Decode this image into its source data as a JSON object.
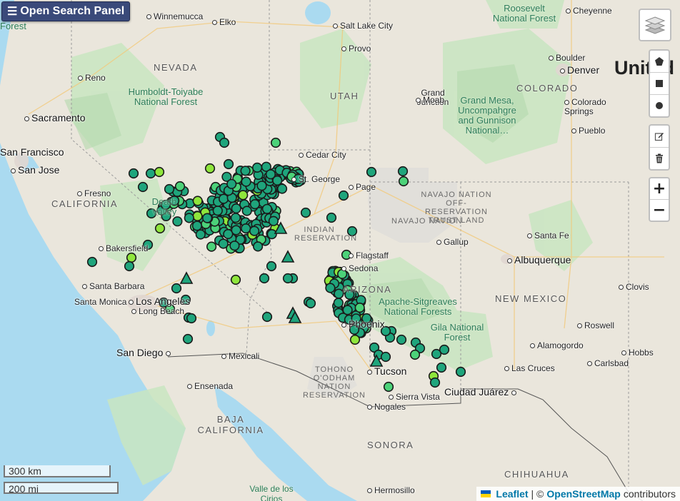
{
  "ui": {
    "open_panel_label": "Open Search Panel",
    "menu_icon": "☰",
    "zoom_in": "+",
    "zoom_out": "−",
    "scale_km": "300 km",
    "scale_mi": "200 mi",
    "attribution": {
      "leaflet": "Leaflet",
      "separator": " | © ",
      "osm": "OpenStreetMap",
      "suffix": "contributors"
    },
    "draw_tools": [
      "draw-polygon",
      "draw-rectangle",
      "draw-circle"
    ],
    "edit_tools": [
      "edit-layers",
      "delete-layers"
    ]
  },
  "map": {
    "state_labels": [
      "NEVADA",
      "UTAH",
      "COLORADO",
      "CALIFORNIA",
      "ARIZONA",
      "NEW MEXICO",
      "BAJA CALIFORNIA",
      "SONORA",
      "CHIHUAHUA"
    ],
    "country_label": "United",
    "cities": [
      "Winnemucca",
      "Elko",
      "Salt Lake City",
      "Provo",
      "Cheyenne",
      "Boulder",
      "Denver",
      "Reno",
      "Sacramento",
      "San Francisco",
      "San Jose",
      "Fresno",
      "Bakersfield",
      "Santa Barbara",
      "Santa Monica",
      "Los Angeles",
      "Long Beach",
      "San Diego",
      "Ensenada",
      "Mexicali",
      "Cedar City",
      "St. George",
      "Page",
      "Grand Junction",
      "Moab",
      "Colorado Springs",
      "Pueblo",
      "Gallup",
      "Santa Fe",
      "Albuquerque",
      "Flagstaff",
      "Sedona",
      "Phoenix",
      "Tucson",
      "Nogales",
      "Sierra Vista",
      "Ciudad Juárez",
      "Las Cruces",
      "Roswell",
      "Alamogordo",
      "Hobbs",
      "Carlsbad",
      "Clovis",
      "Hermosillo"
    ],
    "parks": [
      "Humboldt-Toiyabe National Forest",
      "Grand Mesa, Uncompahgre and Gunnison National…",
      "Apache-Sitgreaves National Forests",
      "Gila National Forest",
      "Death Valley",
      "Roosevelt National Forest",
      "Valle de los Cirios"
    ],
    "reservations": [
      "NAVAJO NATION OFF-RESERVATION TRUST LAND",
      "NAVAJO NATION",
      "INDIAN RESERVATION",
      "TOHONO O'ODHAM NATION RESERVATION"
    ],
    "partial_labels": [
      "Forest",
      "Forest"
    ]
  },
  "colors": {
    "marker_dark": "#1fa57c",
    "marker_light": "#8fe63c",
    "marker_mid": "#4cd279",
    "water": "#aadaf0",
    "panel_bg": "#3a4a7a"
  }
}
